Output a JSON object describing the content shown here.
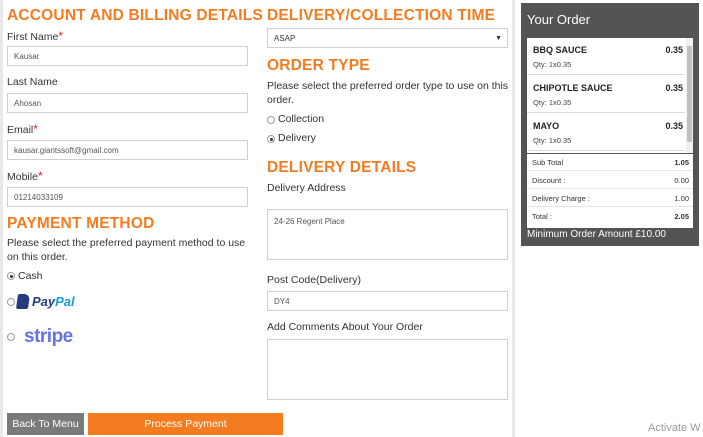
{
  "account": {
    "heading": "ACCOUNT AND BILLING DETAILS",
    "first_name_label": "First Name",
    "first_name_value": "Kausar",
    "last_name_label": "Last Name",
    "last_name_value": "Ahosan",
    "email_label": "Email",
    "email_value": "kausar.giantssoft@gmail.com",
    "mobile_label": "Mobile",
    "mobile_value": "01214033109",
    "required_mark": "*"
  },
  "payment": {
    "heading": "PAYMENT METHOD",
    "description": "Please select the preferred payment method to use on this order.",
    "options": [
      {
        "label": "Cash",
        "selected": true
      },
      {
        "label": "PayPal",
        "selected": false,
        "logo_parts": [
          "Pay",
          "Pal"
        ]
      },
      {
        "label": "stripe",
        "selected": false
      }
    ]
  },
  "delivery_time": {
    "heading": "DELIVERY/COLLECTION TIME",
    "selected": "ASAP"
  },
  "order_type": {
    "heading": "ORDER TYPE",
    "description": "Please select the preferred order type to use on this order.",
    "options": [
      {
        "label": "Collection",
        "selected": false
      },
      {
        "label": "Delivery",
        "selected": true
      }
    ]
  },
  "delivery_details": {
    "heading": "DELIVERY DETAILS",
    "address_label": "Delivery Address",
    "address_value": "24-26 Regent Place",
    "postcode_label": "Post Code(Delivery)",
    "postcode_value": "DY4",
    "comments_label": "Add Comments About Your Order",
    "comments_value": ""
  },
  "buttons": {
    "back": "Back To Menu",
    "process": "Process Payment"
  },
  "order": {
    "title": "Your Order",
    "items": [
      {
        "name": "BBQ SAUCE",
        "qty": "Qty: 1x0.35",
        "price": "0.35"
      },
      {
        "name": "CHIPOTLE SAUCE",
        "qty": "Qty: 1x0.35",
        "price": "0.35"
      },
      {
        "name": "MAYO",
        "qty": "Qty: 1x0.35",
        "price": "0.35"
      }
    ],
    "totals": [
      {
        "label": "Sub Total",
        "value": "1.05"
      },
      {
        "label": "Discount :",
        "value": "0.00"
      },
      {
        "label": "Delivery Charge :",
        "value": "1.00"
      },
      {
        "label": "Total :",
        "value": "2.05"
      }
    ],
    "minimum": "Minimum Order Amount £10.00"
  },
  "watermark": "Activate W",
  "colors": {
    "accent": "#f47c20",
    "panel": "#545454",
    "back_button": "#7b7b7b"
  }
}
